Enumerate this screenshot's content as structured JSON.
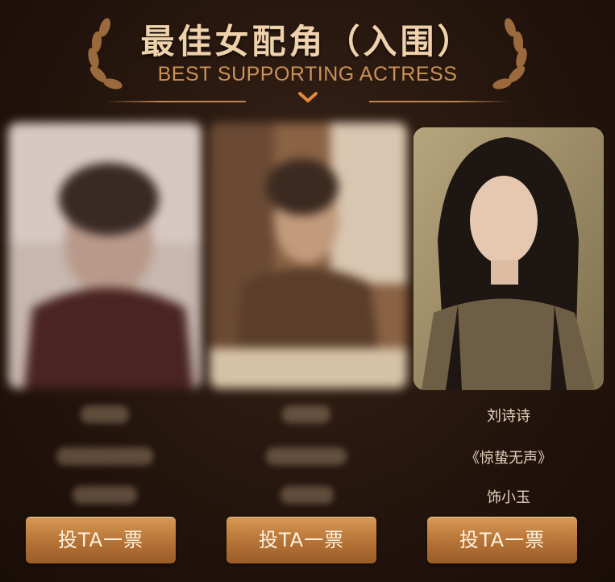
{
  "header": {
    "title_cn": "最佳女配角（入围）",
    "title_en": "BEST SUPPORTING ACTRESS"
  },
  "nominees": [
    {
      "name": "",
      "work": "",
      "role": "",
      "vote_label": "投TA一票",
      "obscured": true
    },
    {
      "name": "",
      "work": "",
      "role": "",
      "vote_label": "投TA一票",
      "obscured": true
    },
    {
      "name": "刘诗诗",
      "work": "《惊蛰无声》",
      "role": "饰小玉",
      "vote_label": "投TA一票",
      "obscured": false
    }
  ],
  "colors": {
    "background": "#24150d",
    "title_gold": "#efd2ac",
    "accent_copper": "#c99358",
    "button": "#b57236"
  }
}
